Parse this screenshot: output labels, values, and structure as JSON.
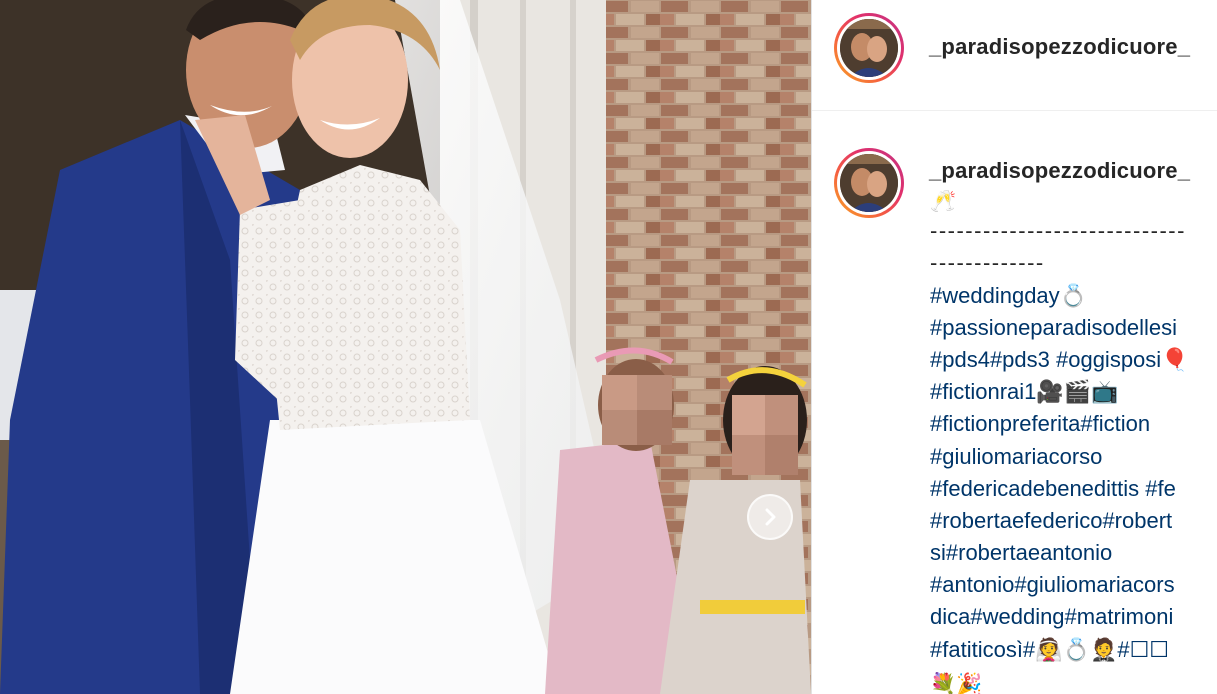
{
  "post": {
    "username": "_paradisopezzodicuore_",
    "header_username": "_paradisopezzodicuore_",
    "caption_lines": [
      {
        "text": "🥂",
        "kind": "emoji"
      },
      {
        "text": "-----------------------------",
        "kind": "dash"
      },
      {
        "text": "-------------",
        "kind": "dash"
      },
      {
        "text": "#weddingday💍",
        "kind": "tag"
      },
      {
        "text": "#passioneparadisodellesi",
        "kind": "tag"
      },
      {
        "text": "#pds4#pds3 #oggisposi🎈",
        "kind": "tag"
      },
      {
        "text": "#fictionrai1🎥🎬📺",
        "kind": "tag"
      },
      {
        "text": "#fictionpreferita#fiction",
        "kind": "tag"
      },
      {
        "text": "#giuliomariacorso",
        "kind": "tag"
      },
      {
        "text": "#federicadebenedittis #fe",
        "kind": "tag"
      },
      {
        "text": "#robertaefederico#robert",
        "kind": "tag"
      },
      {
        "text": "si#robertaeantonio",
        "kind": "tag"
      },
      {
        "text": "#antonio#giuliomariacors",
        "kind": "tag"
      },
      {
        "text": "dica#wedding#matrimoni",
        "kind": "tag"
      },
      {
        "text": "#fatiticosì#👰💍🤵#☐☐",
        "kind": "tag"
      },
      {
        "text": "💐🎉",
        "kind": "emoji"
      }
    ]
  },
  "icons": {
    "avatar": "profile-picture",
    "carousel": "chevron-right-icon"
  },
  "colors": {
    "username": "#262626",
    "hashtag": "#003569",
    "ring_start": "#f9a825",
    "ring_end": "#c13584"
  }
}
